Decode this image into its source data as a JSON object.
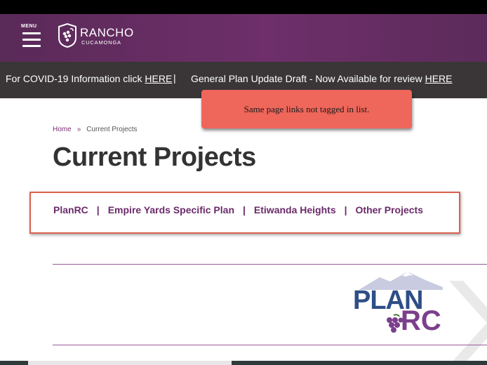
{
  "header": {
    "menu_label": "MENU",
    "logo_title": "RANCHO",
    "logo_subtitle": "CUCAMONGA"
  },
  "alerts": {
    "covid_text": "For COVID-19 Information click ",
    "covid_link": "HERE",
    "separator": "|",
    "plan_text": "General Plan Update Draft - Now Available for review ",
    "plan_link": "HERE"
  },
  "tooltip": {
    "message": "Same page links not tagged in list."
  },
  "breadcrumb": {
    "home": "Home",
    "separator": "»",
    "current": "Current Projects"
  },
  "page": {
    "title": "Current Projects"
  },
  "project_nav": {
    "items": [
      "PlanRC",
      "Empire Yards Specific Plan",
      "Etiwanda Heights",
      "Other Projects"
    ],
    "separator": "|"
  },
  "planrc_logo": {
    "line1": "PLAN",
    "line2": "RC"
  },
  "colors": {
    "brand_purple": "#6e2f6a",
    "alert_bar": "#3a3637",
    "annotation_red": "#ef665a",
    "plan_blue": "#2e4e87"
  },
  "icons": [
    "menu-icon",
    "city-seal-icon",
    "mountain-icon",
    "grape-icon"
  ]
}
